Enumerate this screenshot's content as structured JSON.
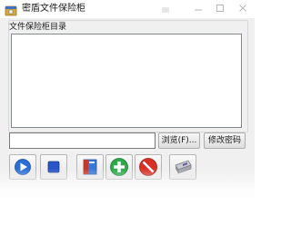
{
  "window": {
    "title": "密盾文件保险柜",
    "app_icon": "file-lock-icon",
    "controls": [
      "minimize-icon",
      "maximize-icon",
      "close-icon"
    ]
  },
  "folder_group": {
    "label": "文件保险柜目录",
    "items": []
  },
  "path_field": {
    "value": "",
    "placeholder": ""
  },
  "buttons": {
    "browse": "浏览(F)...",
    "change_password": "修改密码"
  },
  "toolbar": [
    {
      "icon": "play-icon",
      "color": "#2a6fd6"
    },
    {
      "icon": "stop-icon",
      "color": "#2a55c8"
    },
    {
      "icon": "folder-icon",
      "color": "#3a78d8"
    },
    {
      "icon": "add-icon",
      "color": "#2da84a"
    },
    {
      "icon": "remove-icon",
      "color": "#d93025"
    },
    {
      "icon": "drive-icon",
      "color": "#8a8f98"
    }
  ]
}
